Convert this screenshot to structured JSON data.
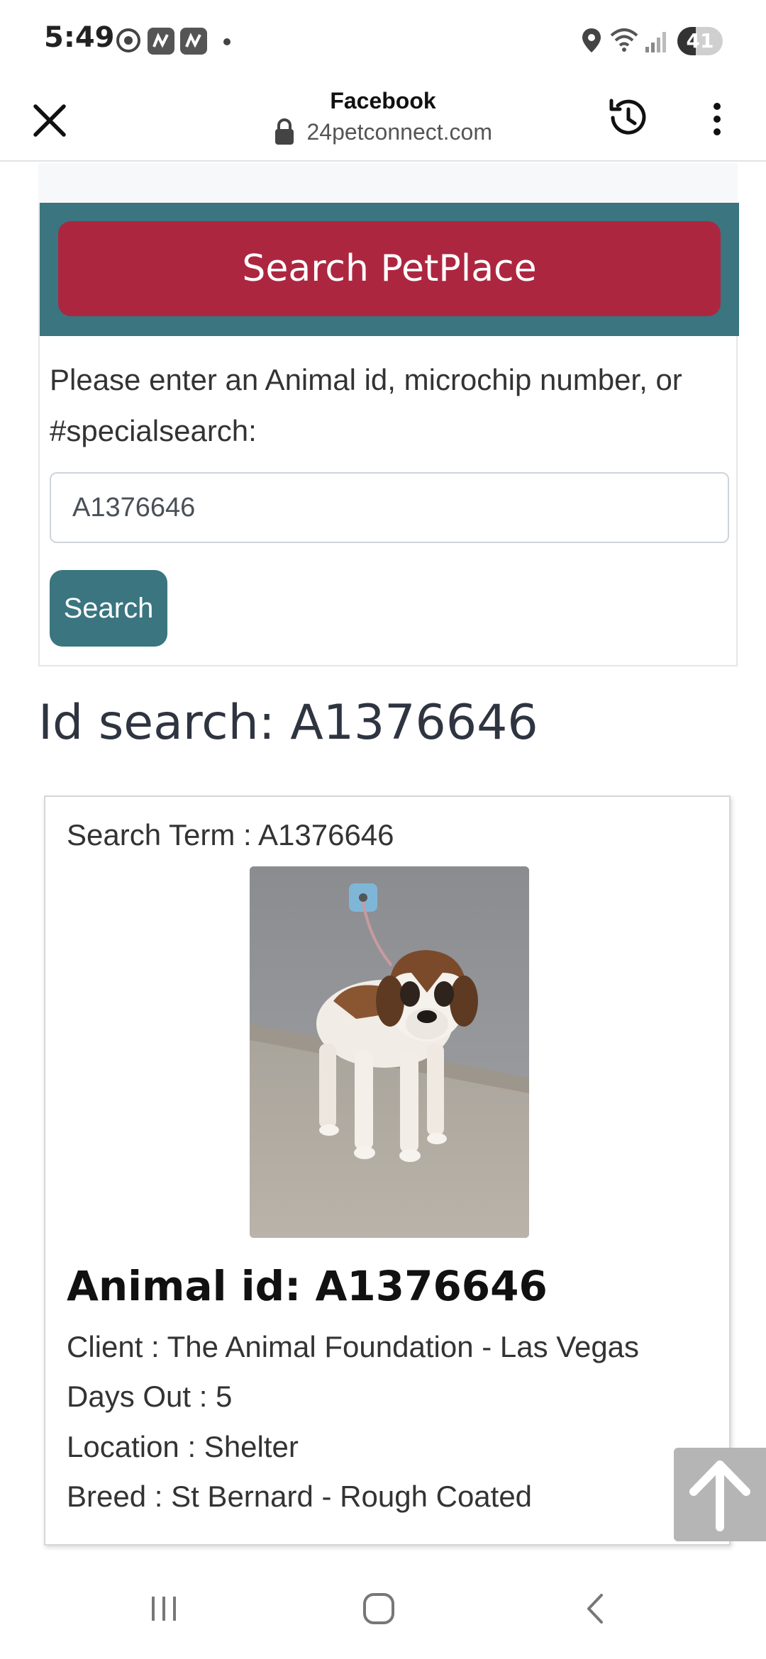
{
  "status_bar": {
    "time": "5:49",
    "battery": "41",
    "battery_level": 0.41
  },
  "browser": {
    "title": "Facebook",
    "url": "24petconnect.com"
  },
  "search_panel": {
    "petplace_button": "Search PetPlace",
    "prompt": "Please enter an Animal id, microchip number, or #specialsearch:",
    "input_value": "A1376646",
    "search_button": "Search"
  },
  "results": {
    "heading": "Id search: A1376646",
    "search_term": "Search Term : A1376646",
    "animal_heading": "Animal id: A1376646",
    "details": [
      "Client : The Animal Foundation - Las Vegas",
      "Days Out : 5",
      "Location : Shelter",
      "Breed : St Bernard - Rough Coated"
    ]
  },
  "colors": {
    "banner": "#3a7580",
    "petplace_button": "#ad2640",
    "search_button": "#3a7580"
  }
}
